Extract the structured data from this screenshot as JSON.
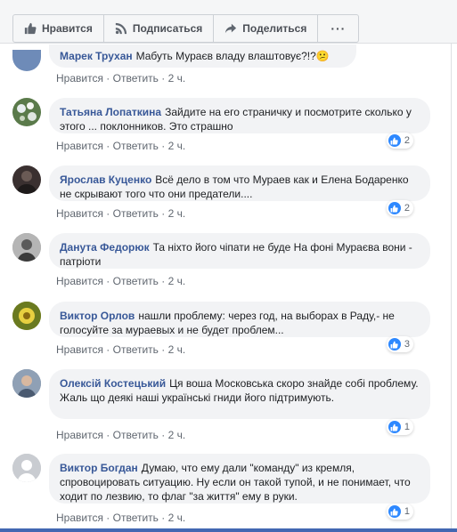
{
  "actions": {
    "like": "Нравится",
    "subscribe": "Подписаться",
    "share": "Поделиться",
    "more": "···"
  },
  "meta_labels": {
    "like": "Нравится",
    "reply": "Ответить",
    "sep": "·"
  },
  "comments": [
    {
      "author": "Марек Трухан",
      "text": "Мабуть Мураєв владу влаштовує?!?",
      "emoji": "😕",
      "time": "2 ч.",
      "reactions": "",
      "avatar_color": "#6e8bb8"
    },
    {
      "author": "Татьяна Лопаткина",
      "text": "Зайдите на его страничку и посмотрите сколько у этого ... поклонников. Это страшно",
      "time": "2 ч.",
      "reactions": "2",
      "avatar_color": "#5a7a4a"
    },
    {
      "author": "Ярослав Куценко",
      "text": "Всё дело в том что Мураев как и Елена Бодаренко не скрывают того что они предатели....",
      "time": "2 ч.",
      "reactions": "2",
      "avatar_color": "#3a3030"
    },
    {
      "author": "Данута Федорюк",
      "text": "Та ніхто його чіпати не буде На фоні Мураєва вони - патріоти",
      "time": "2 ч.",
      "reactions": "",
      "avatar_color": "#8a8a8a"
    },
    {
      "author": "Виктор Орлов",
      "text": "нашли проблему: через год, на выборах в Раду,- не голосуйте за мураевых и не будет проблем...",
      "time": "2 ч.",
      "reactions": "3",
      "avatar_color": "#a8a030"
    },
    {
      "author": "Олексій Костецький",
      "text": "Ця воша Московська скоро знайде собі проблему. Жаль що деякі наші українські гниди його підтримують.",
      "time": "2 ч.",
      "reactions": "1",
      "avatar_color": "#7a8aa0"
    },
    {
      "author": "Виктор Богдан",
      "text": "Думаю, что ему дали \"команду\" из кремля, спровоцировать ситуацию. Ну если он такой тупой, и не понимает, что ходит по лезвию, то флаг \"за життя\" ему в руки.",
      "time": "2 ч.",
      "reactions": "1",
      "avatar_color": "#c9ccd1"
    }
  ],
  "colors": {
    "link": "#385898",
    "like_blue": "#2d88ff",
    "bubble": "#f2f3f5"
  }
}
